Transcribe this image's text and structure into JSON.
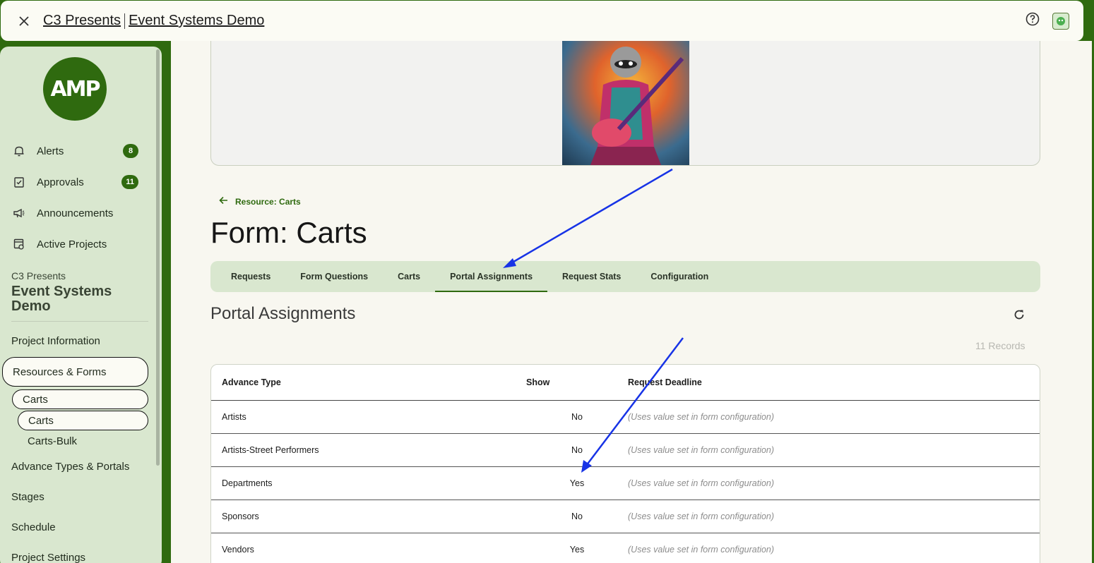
{
  "topbar": {
    "org": "C3 Presents",
    "project": "Event Systems Demo"
  },
  "sidebar": {
    "logo_text": "AMP",
    "nav": [
      {
        "label": "Alerts",
        "icon": "bell-icon",
        "badge": "8"
      },
      {
        "label": "Approvals",
        "icon": "clipboard-check-icon",
        "badge": "11"
      },
      {
        "label": "Announcements",
        "icon": "megaphone-icon",
        "badge": ""
      },
      {
        "label": "Active Projects",
        "icon": "projects-icon",
        "badge": ""
      }
    ],
    "project_org": "C3 Presents",
    "project_name": "Event Systems Demo",
    "menu": {
      "project_information": "Project Information",
      "resources_forms": "Resources & Forms",
      "carts_group": "Carts",
      "carts": "Carts",
      "carts_bulk": "Carts-Bulk",
      "advance_types": "Advance Types & Portals",
      "stages": "Stages",
      "schedule": "Schedule",
      "project_settings": "Project Settings"
    }
  },
  "main": {
    "back_link": "Resource: Carts",
    "title": "Form: Carts",
    "tabs": [
      {
        "label": "Requests"
      },
      {
        "label": "Form Questions"
      },
      {
        "label": "Carts"
      },
      {
        "label": "Portal Assignments",
        "active": true
      },
      {
        "label": "Request Stats"
      },
      {
        "label": "Configuration"
      }
    ],
    "section_title": "Portal Assignments",
    "records": "11 Records",
    "table": {
      "headers": [
        "Advance Type",
        "Show",
        "Request Deadline"
      ],
      "rows": [
        [
          "Artists",
          "No",
          "(Uses value set in form configuration)"
        ],
        [
          "Artists-Street Performers",
          "No",
          "(Uses value set in form configuration)"
        ],
        [
          "Departments",
          "Yes",
          "(Uses value set in form configuration)"
        ],
        [
          "Sponsors",
          "No",
          "(Uses value set in form configuration)"
        ],
        [
          "Vendors",
          "Yes",
          "(Uses value set in form configuration)"
        ]
      ]
    }
  },
  "colors": {
    "brand": "#2f6a0f",
    "sidebar_bg": "#d9e7cf",
    "annotation_arrow": "#1733e6"
  }
}
